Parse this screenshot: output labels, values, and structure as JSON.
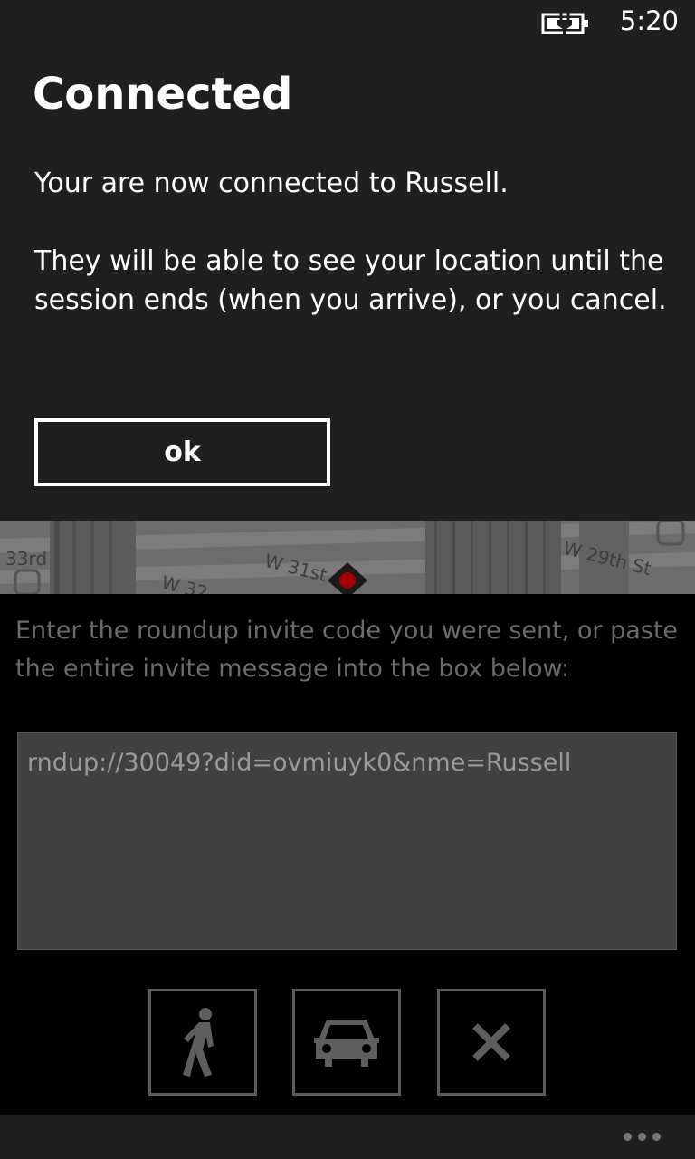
{
  "status_bar": {
    "time": "5:20",
    "battery_icon": "battery-charging-icon"
  },
  "dialog": {
    "title": "Connected",
    "message_1": "Your are now connected to Russell.",
    "message_2": "They will be able to see your location until the session ends (when you arrive), or you cancel.",
    "ok_label": "ok"
  },
  "map": {
    "street_labels": [
      "33rd",
      "W 31st",
      "W 29th St",
      "W 32"
    ],
    "marker_color": "#c00000"
  },
  "app": {
    "instructions": "Enter the roundup invite code you were sent, or paste the entire invite message into the box below:",
    "invite_value": "rndup://30049?did=ovmiuyk0&nme=Russell",
    "buttons": [
      {
        "name": "walk",
        "icon": "pedestrian-icon"
      },
      {
        "name": "drive",
        "icon": "car-icon"
      },
      {
        "name": "cancel",
        "icon": "close-icon"
      }
    ],
    "more_icon": "ellipsis-icon"
  }
}
